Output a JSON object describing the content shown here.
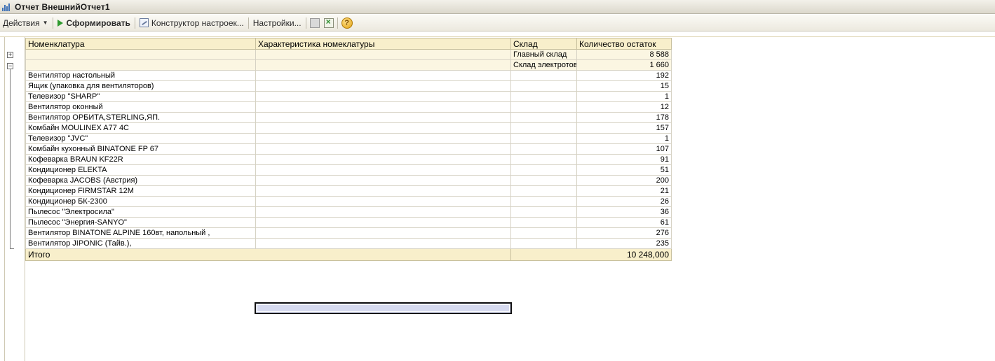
{
  "window": {
    "title": "Отчет  ВнешнийОтчет1"
  },
  "toolbar": {
    "actions_label": "Действия",
    "generate_label": "Сформировать",
    "constructor_label": "Конструктор настроек...",
    "settings_label": "Настройки..."
  },
  "icons": {
    "app": "chart-icon",
    "generate": "play-icon",
    "constructor": "constructor-icon",
    "disabled_tool": "document-icon",
    "export": "export-icon",
    "help": "help-icon"
  },
  "colors": {
    "header_bg": "#f8efcb",
    "group_bg": "#fbf6e2",
    "selection": "#d6daf0"
  },
  "table": {
    "columns": [
      "Номенклатура",
      "Характеристика номеклатуры",
      "Склад",
      "Количество остаток"
    ],
    "groups": [
      {
        "warehouse": "Главный склад",
        "qty": "8 588"
      },
      {
        "warehouse": "Склад электротов",
        "qty": "1 660"
      }
    ],
    "rows": [
      {
        "name": "Вентилятор настольный",
        "qty": "192"
      },
      {
        "name": "Ящик (упаковка для вентиляторов)",
        "qty": "15"
      },
      {
        "name": "Телевизор \"SHARP\"",
        "qty": "1"
      },
      {
        "name": "Вентилятор оконный",
        "qty": "12"
      },
      {
        "name": "Вентилятор ОРБИТА,STERLING,ЯП.",
        "qty": "178"
      },
      {
        "name": "Комбайн MOULINEX  A77 4C",
        "qty": "157"
      },
      {
        "name": "Телевизор \"JVC\"",
        "qty": "1"
      },
      {
        "name": "Комбайн кухонный BINATONE FP 67",
        "qty": "107"
      },
      {
        "name": "Кофеварка BRAUN KF22R",
        "qty": "91"
      },
      {
        "name": "Кондиционер ELEKTA",
        "qty": "51"
      },
      {
        "name": "Кофеварка JACOBS (Австрия)",
        "qty": "200"
      },
      {
        "name": "Кондиционер FIRMSTAR 12M",
        "qty": "21"
      },
      {
        "name": "Кондиционер БК-2300",
        "qty": "26"
      },
      {
        "name": "Пылесос \"Электросила\"",
        "qty": "36"
      },
      {
        "name": "Пылесос \"Энергия-SANYO\"",
        "qty": "61"
      },
      {
        "name": "Вентилятор BINATONE ALPINE 160вт, напольный ,",
        "qty": "276"
      },
      {
        "name": "Вентилятор JIPONIC (Тайв.),",
        "qty": "235"
      }
    ],
    "total_label": "Итого",
    "total_value": "10 248,000"
  }
}
